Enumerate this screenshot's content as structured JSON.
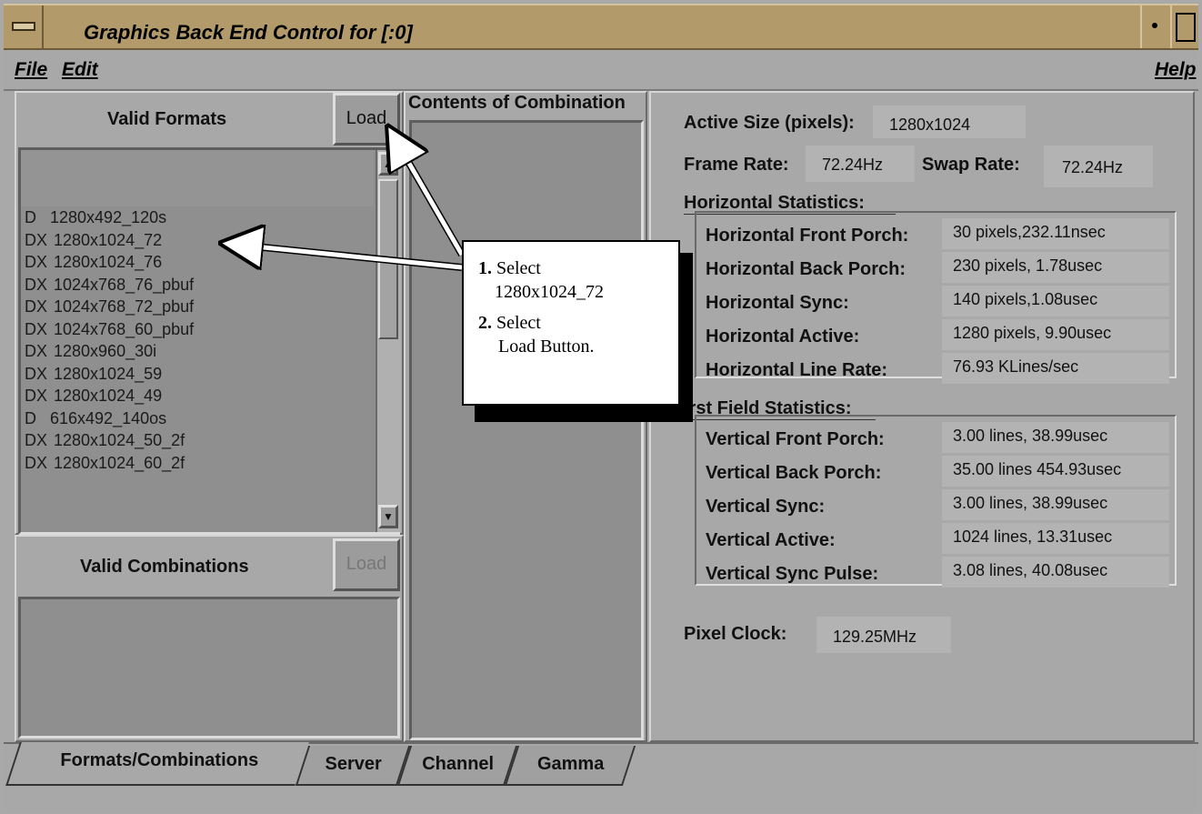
{
  "window": {
    "title": "Graphics Back End Control for [:0]"
  },
  "menu": {
    "file": "File",
    "edit": "Edit",
    "help": "Help"
  },
  "formats": {
    "heading": "Valid Formats",
    "load_label": "Load",
    "items": [
      {
        "flag": "D",
        "name": "1280x492_120s"
      },
      {
        "flag": "DX",
        "name": "1280x1024_72"
      },
      {
        "flag": "DX",
        "name": "1280x1024_76"
      },
      {
        "flag": "DX",
        "name": "1024x768_76_pbuf"
      },
      {
        "flag": "DX",
        "name": "1024x768_72_pbuf"
      },
      {
        "flag": "DX",
        "name": "1024x768_60_pbuf"
      },
      {
        "flag": "DX",
        "name": "1280x960_30i"
      },
      {
        "flag": "DX",
        "name": "1280x1024_59"
      },
      {
        "flag": "DX",
        "name": "1280x1024_49"
      },
      {
        "flag": "D",
        "name": "616x492_140os"
      },
      {
        "flag": "DX",
        "name": "1280x1024_50_2f"
      },
      {
        "flag": "DX",
        "name": "1280x1024_60_2f"
      }
    ]
  },
  "combinations": {
    "heading": "Valid Combinations",
    "load_label": "Load"
  },
  "contents": {
    "heading": "Contents of Combination"
  },
  "callout": {
    "step1_num": "1.",
    "step1_text": "Select",
    "step1_value": "1280x1024_72",
    "step2_num": "2.",
    "step2_text": "Select",
    "step2_value": "Load Button."
  },
  "details": {
    "active_size_label": "Active Size (pixels):",
    "active_size": "1280x1024",
    "frame_rate_label": "Frame Rate:",
    "frame_rate": "72.24Hz",
    "swap_rate_label": "Swap Rate:",
    "swap_rate": "72.24Hz",
    "horizontal_heading": "Horizontal Statistics:",
    "horizontal": [
      {
        "label": "Horizontal Front Porch:",
        "value": "30 pixels,232.11nsec"
      },
      {
        "label": "Horizontal Back Porch:",
        "value": "230 pixels, 1.78usec"
      },
      {
        "label": "Horizontal Sync:",
        "value": "140 pixels,1.08usec"
      },
      {
        "label": "Horizontal Active:",
        "value": "1280 pixels, 9.90usec"
      },
      {
        "label": "Horizontal Line Rate:",
        "value": "76.93 KLines/sec"
      }
    ],
    "field_heading": "irst Field Statistics:",
    "vertical": [
      {
        "label": "Vertical Front Porch:",
        "value": "3.00 lines, 38.99usec"
      },
      {
        "label": "Vertical Back Porch:",
        "value": "35.00 lines 454.93usec"
      },
      {
        "label": "Vertical Sync:",
        "value": "3.00 lines, 38.99usec"
      },
      {
        "label": "Vertical Active:",
        "value": "1024 lines, 13.31usec"
      },
      {
        "label": "Vertical Sync Pulse:",
        "value": "3.08 lines, 40.08usec"
      }
    ],
    "pixel_clock_label": "Pixel Clock:",
    "pixel_clock": "129.25MHz"
  },
  "tabs": [
    "Formats/Combinations",
    "Server",
    "Channel",
    "Gamma"
  ]
}
